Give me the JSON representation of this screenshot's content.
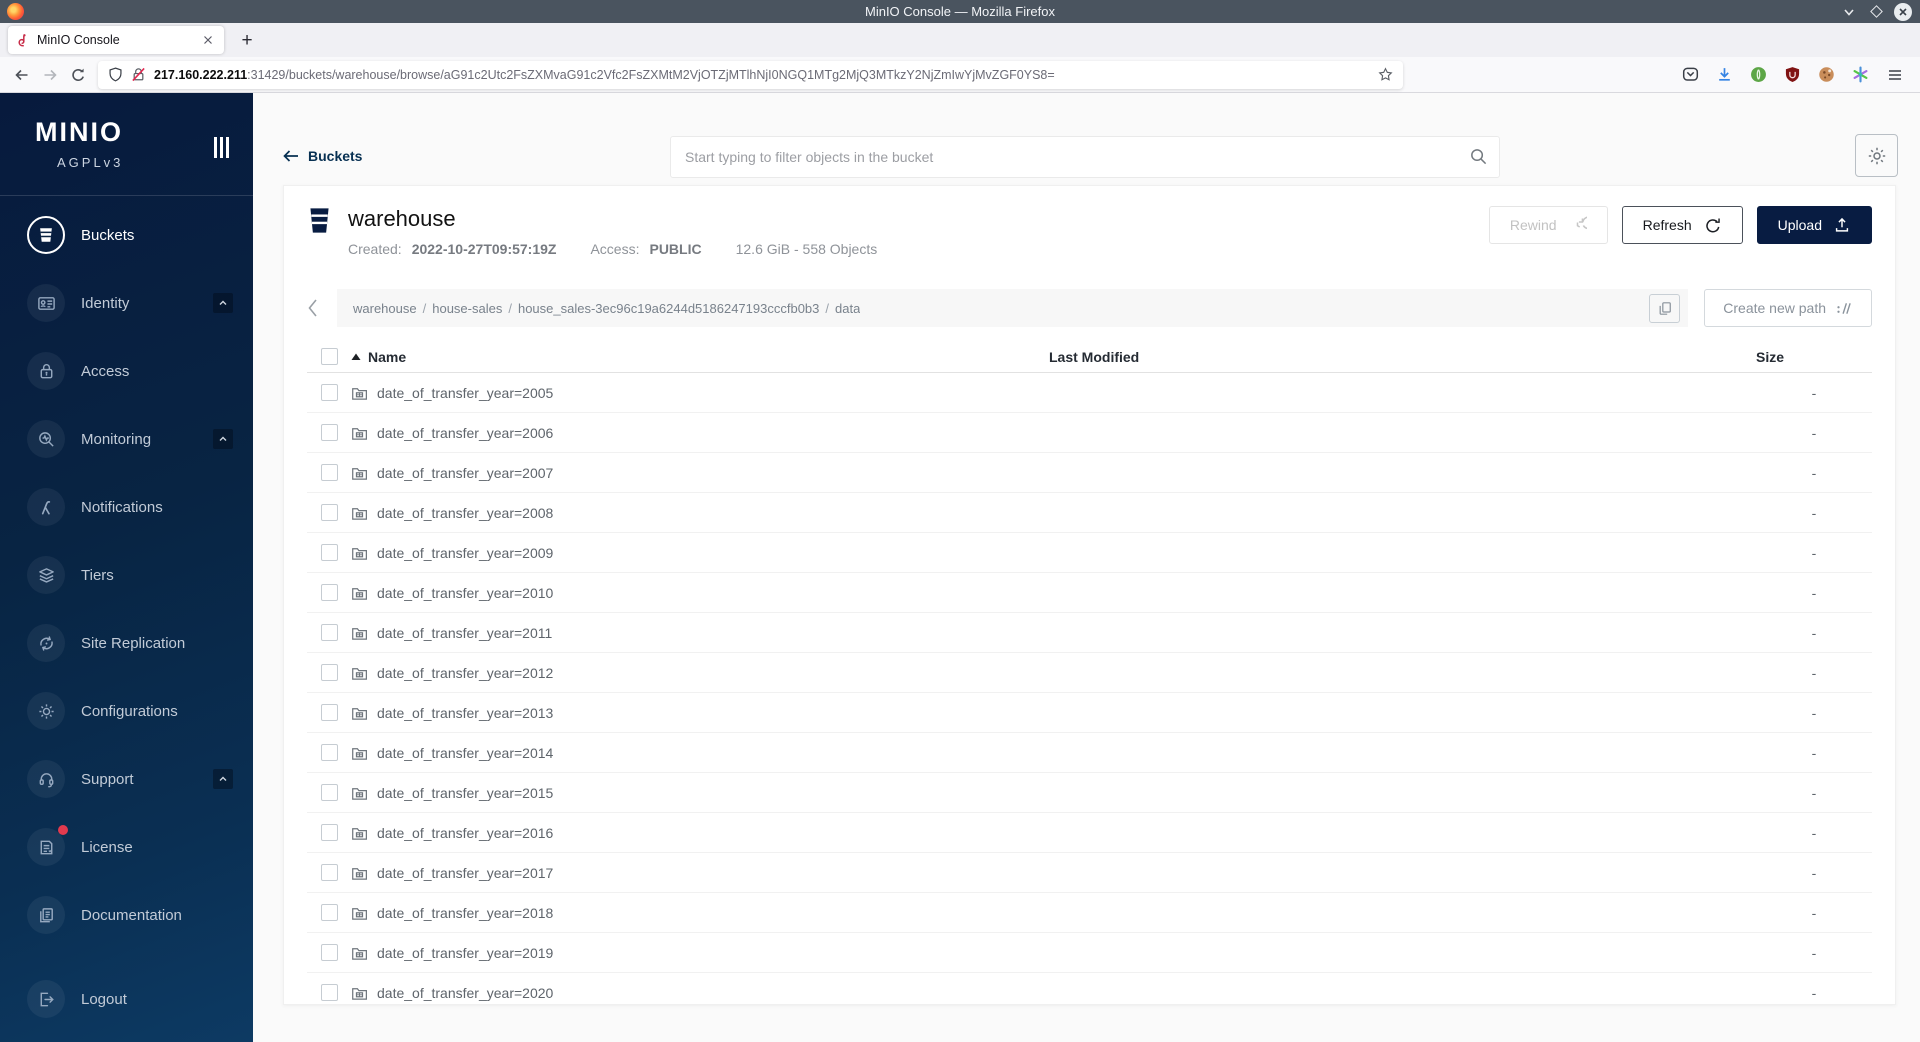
{
  "window": {
    "title": "MinIO Console — Mozilla Firefox"
  },
  "browser": {
    "tab_title": "MinIO Console",
    "new_tab_button": "+",
    "url_host": "217.160.222.211",
    "url_path": ":31429/buckets/warehouse/browse/aG91c2Utc2FsZXMvaG91c2Vfc2FsZXMtM2VjOTZjMTlhNjI0NGQ1MTg2MjQ3MTkzY2NjZmIwYjMvZGF0YS8="
  },
  "sidebar": {
    "logo": "MINIO",
    "license_tag": "AGPLv3",
    "items": [
      {
        "label": "Buckets",
        "active": true
      },
      {
        "label": "Identity",
        "expandable": true
      },
      {
        "label": "Access"
      },
      {
        "label": "Monitoring",
        "expandable": true
      },
      {
        "label": "Notifications"
      },
      {
        "label": "Tiers"
      },
      {
        "label": "Site Replication"
      },
      {
        "label": "Configurations"
      },
      {
        "label": "Support",
        "expandable": true
      },
      {
        "label": "License",
        "badge": true
      },
      {
        "label": "Documentation"
      },
      {
        "label": "Logout"
      }
    ]
  },
  "header": {
    "back_label": "Buckets",
    "search_placeholder": "Start typing to filter objects in the bucket"
  },
  "bucket": {
    "name": "warehouse",
    "created_label": "Created:",
    "created_value": "2022-10-27T09:57:19Z",
    "access_label": "Access:",
    "access_value": "PUBLIC",
    "usage": "12.6 GiB - 558 Objects"
  },
  "actions": {
    "rewind": "Rewind",
    "refresh": "Refresh",
    "upload": "Upload",
    "create_path": "Create new path"
  },
  "breadcrumb": {
    "segments": [
      "warehouse",
      "house-sales",
      "house_sales-3ec96c19a6244d5186247193cccfb0b3",
      "data"
    ],
    "separator": "/"
  },
  "table": {
    "headers": {
      "name": "Name",
      "modified": "Last Modified",
      "size": "Size"
    },
    "rows": [
      {
        "name": "date_of_transfer_year=2005",
        "size": "-"
      },
      {
        "name": "date_of_transfer_year=2006",
        "size": "-"
      },
      {
        "name": "date_of_transfer_year=2007",
        "size": "-"
      },
      {
        "name": "date_of_transfer_year=2008",
        "size": "-"
      },
      {
        "name": "date_of_transfer_year=2009",
        "size": "-"
      },
      {
        "name": "date_of_transfer_year=2010",
        "size": "-"
      },
      {
        "name": "date_of_transfer_year=2011",
        "size": "-"
      },
      {
        "name": "date_of_transfer_year=2012",
        "size": "-"
      },
      {
        "name": "date_of_transfer_year=2013",
        "size": "-"
      },
      {
        "name": "date_of_transfer_year=2014",
        "size": "-"
      },
      {
        "name": "date_of_transfer_year=2015",
        "size": "-"
      },
      {
        "name": "date_of_transfer_year=2016",
        "size": "-"
      },
      {
        "name": "date_of_transfer_year=2017",
        "size": "-"
      },
      {
        "name": "date_of_transfer_year=2018",
        "size": "-"
      },
      {
        "name": "date_of_transfer_year=2019",
        "size": "-"
      },
      {
        "name": "date_of_transfer_year=2020",
        "size": "-"
      }
    ]
  },
  "colors": {
    "accent_navy": "#081C42",
    "link_navy": "#073052",
    "sidebar_gradient_top": "#071A3D",
    "sidebar_gradient_bottom": "#0D3A63",
    "badge_red": "#E23A4E",
    "download_blue": "#3584E4",
    "ublock_red": "#801313"
  }
}
